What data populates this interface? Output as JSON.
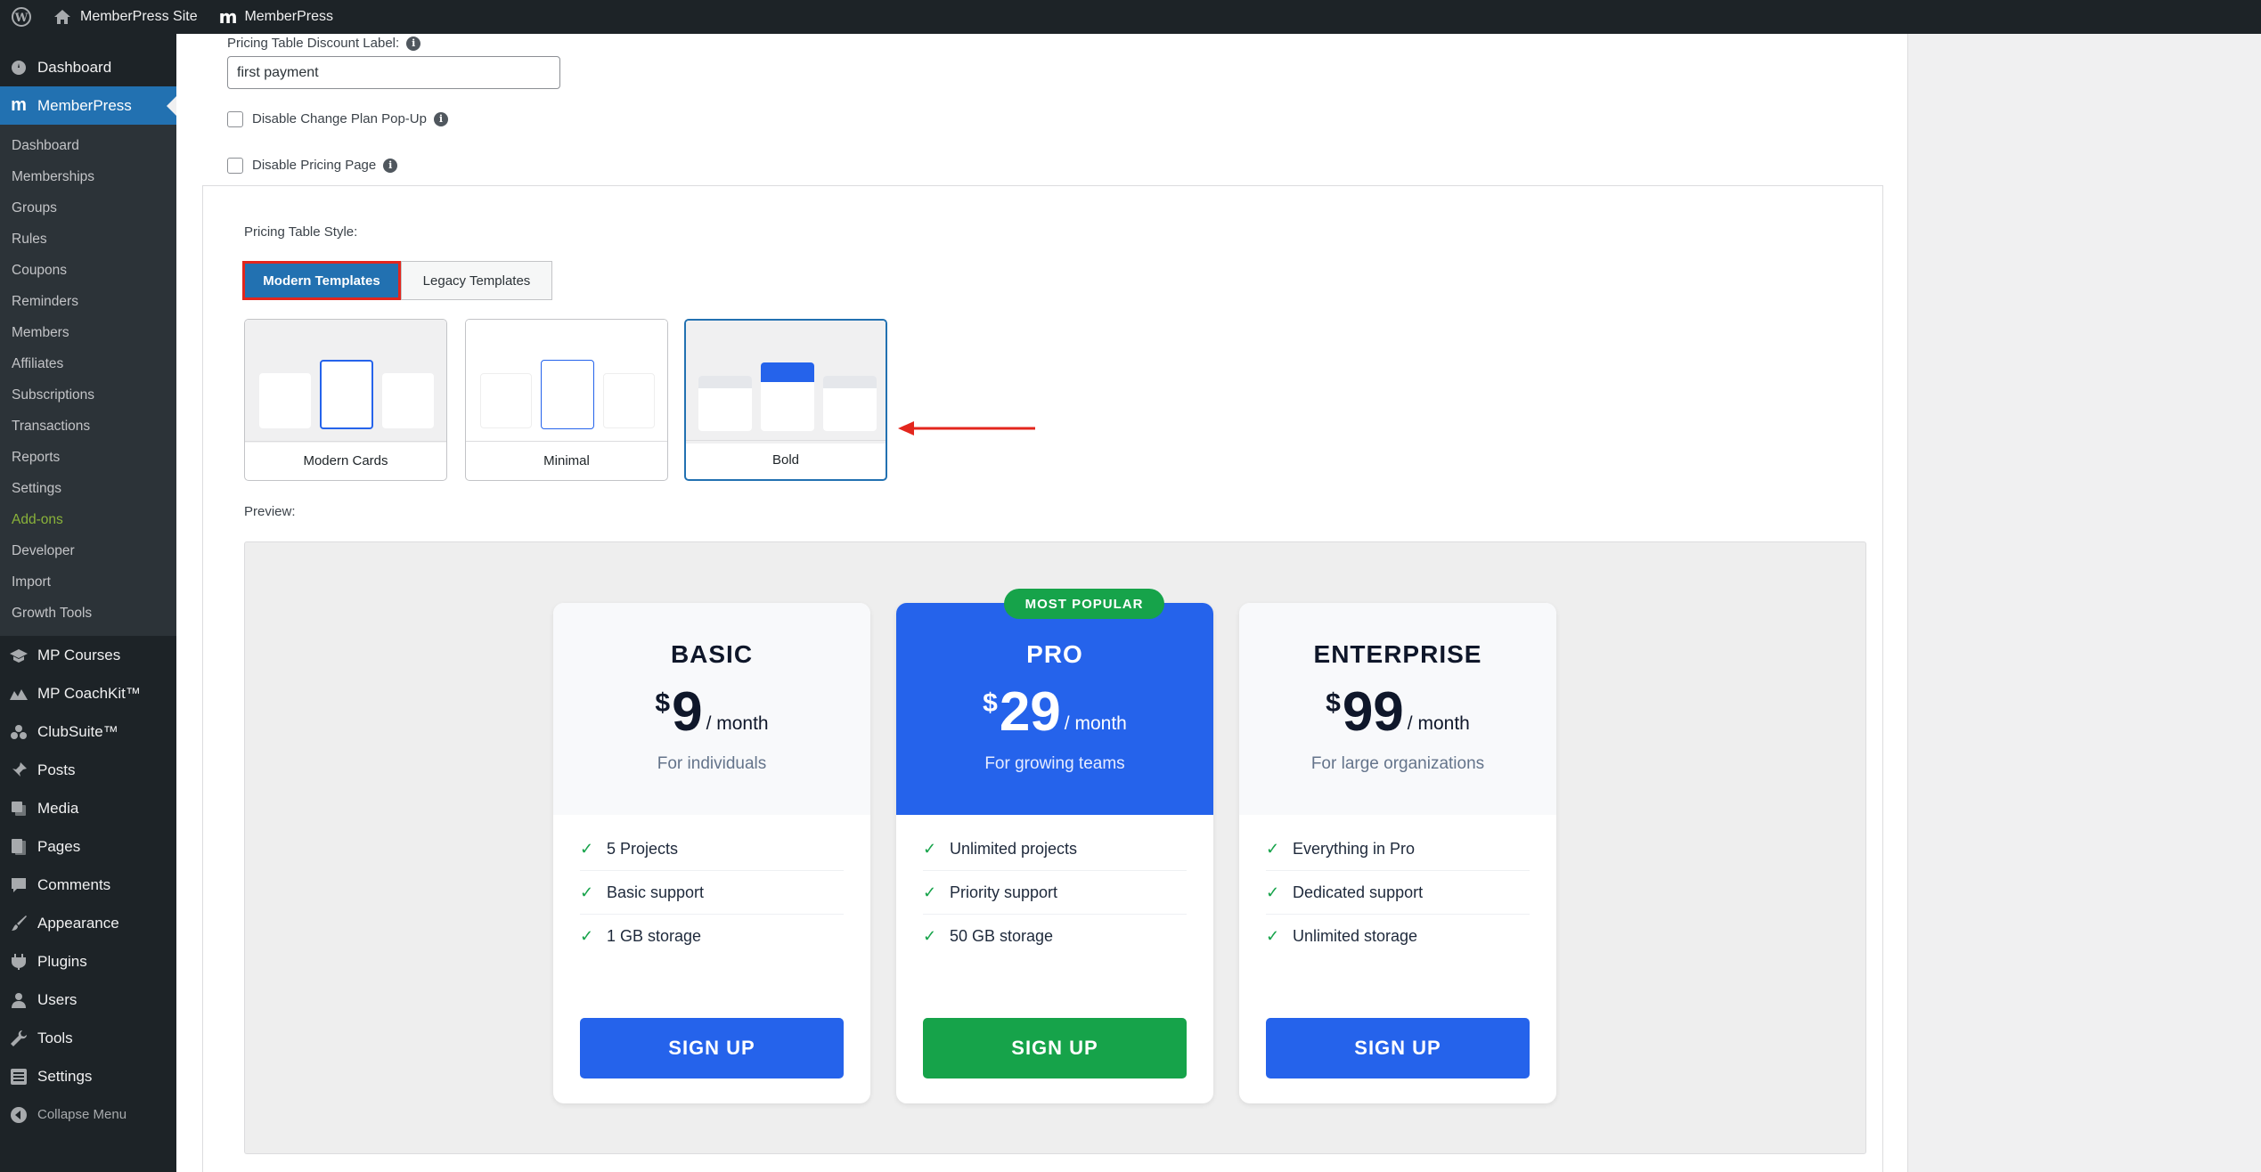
{
  "adminbar": {
    "site_name": "MemberPress Site",
    "plugin_name": "MemberPress"
  },
  "sidebar": {
    "top_items": [
      {
        "label": "Dashboard",
        "icon": "dashboard-icon"
      },
      {
        "label": "MemberPress",
        "icon": "memberpress-icon"
      }
    ],
    "memberpress_submenu": [
      "Dashboard",
      "Memberships",
      "Groups",
      "Rules",
      "Coupons",
      "Reminders",
      "Members",
      "Affiliates",
      "Subscriptions",
      "Transactions",
      "Reports",
      "Settings",
      "Add-ons",
      "Developer",
      "Import",
      "Growth Tools"
    ],
    "bottom_items": [
      {
        "label": "MP Courses",
        "icon": "courses-icon"
      },
      {
        "label": "MP CoachKit™",
        "icon": "coachkit-icon"
      },
      {
        "label": "ClubSuite™",
        "icon": "clubsuite-icon"
      },
      {
        "label": "Posts",
        "icon": "pin-icon"
      },
      {
        "label": "Media",
        "icon": "media-icon"
      },
      {
        "label": "Pages",
        "icon": "pages-icon"
      },
      {
        "label": "Comments",
        "icon": "comments-icon"
      },
      {
        "label": "Appearance",
        "icon": "paintbrush-icon"
      },
      {
        "label": "Plugins",
        "icon": "plugins-icon"
      },
      {
        "label": "Users",
        "icon": "users-icon"
      },
      {
        "label": "Tools",
        "icon": "wrench-icon"
      },
      {
        "label": "Settings",
        "icon": "settings-icon"
      }
    ],
    "collapse_label": "Collapse Menu",
    "addon_color": "#8ab33a"
  },
  "form": {
    "discount_label": "Pricing Table Discount Label:",
    "discount_value": "first payment",
    "disable_change_plan": "Disable Change Plan Pop-Up",
    "disable_pricing_page": "Disable Pricing Page",
    "style_label": "Pricing Table Style:",
    "tab_modern": "Modern Templates",
    "tab_legacy": "Legacy Templates",
    "templates": [
      "Modern Cards",
      "Minimal",
      "Bold"
    ],
    "selected_template": "Bold",
    "preview_label": "Preview:"
  },
  "preview": {
    "badge": "MOST POPULAR",
    "plans": [
      {
        "name": "BASIC",
        "currency": "$",
        "amount": "9",
        "period": "/ month",
        "desc": "For individuals",
        "features": [
          "5 Projects",
          "Basic support",
          "1 GB storage"
        ],
        "button": "SIGN UP"
      },
      {
        "name": "PRO",
        "currency": "$",
        "amount": "29",
        "period": "/ month",
        "desc": "For growing teams",
        "features": [
          "Unlimited projects",
          "Priority support",
          "50 GB storage"
        ],
        "button": "SIGN UP"
      },
      {
        "name": "ENTERPRISE",
        "currency": "$",
        "amount": "99",
        "period": "/ month",
        "desc": "For large organizations",
        "features": [
          "Everything in Pro",
          "Dedicated support",
          "Unlimited storage"
        ],
        "button": "SIGN UP"
      }
    ],
    "colors": {
      "primary": "#2563eb",
      "popular": "#16a34a",
      "check": "#16a34a"
    }
  }
}
